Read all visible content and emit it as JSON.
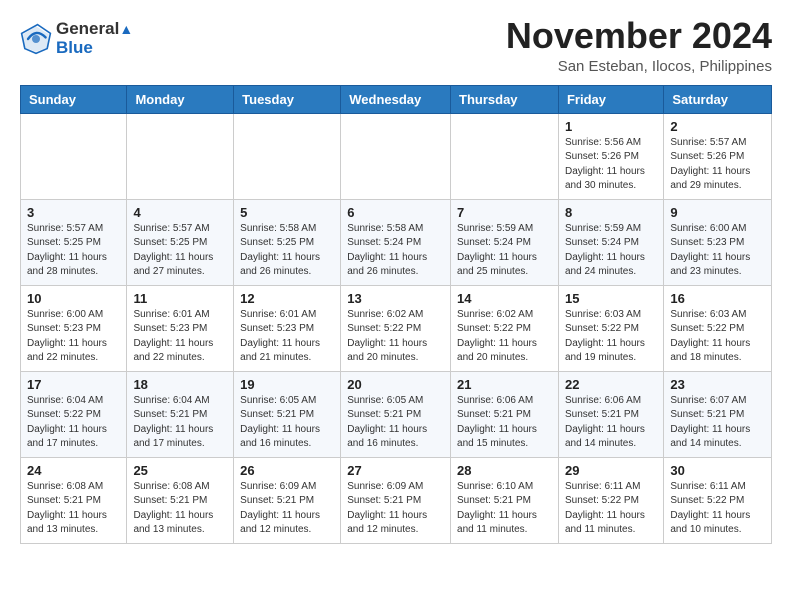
{
  "header": {
    "logo_line1": "General",
    "logo_line2": "Blue",
    "month": "November 2024",
    "location": "San Esteban, Ilocos, Philippines"
  },
  "weekdays": [
    "Sunday",
    "Monday",
    "Tuesday",
    "Wednesday",
    "Thursday",
    "Friday",
    "Saturday"
  ],
  "weeks": [
    [
      {
        "day": "",
        "info": ""
      },
      {
        "day": "",
        "info": ""
      },
      {
        "day": "",
        "info": ""
      },
      {
        "day": "",
        "info": ""
      },
      {
        "day": "",
        "info": ""
      },
      {
        "day": "1",
        "info": "Sunrise: 5:56 AM\nSunset: 5:26 PM\nDaylight: 11 hours and 30 minutes."
      },
      {
        "day": "2",
        "info": "Sunrise: 5:57 AM\nSunset: 5:26 PM\nDaylight: 11 hours and 29 minutes."
      }
    ],
    [
      {
        "day": "3",
        "info": "Sunrise: 5:57 AM\nSunset: 5:25 PM\nDaylight: 11 hours and 28 minutes."
      },
      {
        "day": "4",
        "info": "Sunrise: 5:57 AM\nSunset: 5:25 PM\nDaylight: 11 hours and 27 minutes."
      },
      {
        "day": "5",
        "info": "Sunrise: 5:58 AM\nSunset: 5:25 PM\nDaylight: 11 hours and 26 minutes."
      },
      {
        "day": "6",
        "info": "Sunrise: 5:58 AM\nSunset: 5:24 PM\nDaylight: 11 hours and 26 minutes."
      },
      {
        "day": "7",
        "info": "Sunrise: 5:59 AM\nSunset: 5:24 PM\nDaylight: 11 hours and 25 minutes."
      },
      {
        "day": "8",
        "info": "Sunrise: 5:59 AM\nSunset: 5:24 PM\nDaylight: 11 hours and 24 minutes."
      },
      {
        "day": "9",
        "info": "Sunrise: 6:00 AM\nSunset: 5:23 PM\nDaylight: 11 hours and 23 minutes."
      }
    ],
    [
      {
        "day": "10",
        "info": "Sunrise: 6:00 AM\nSunset: 5:23 PM\nDaylight: 11 hours and 22 minutes."
      },
      {
        "day": "11",
        "info": "Sunrise: 6:01 AM\nSunset: 5:23 PM\nDaylight: 11 hours and 22 minutes."
      },
      {
        "day": "12",
        "info": "Sunrise: 6:01 AM\nSunset: 5:23 PM\nDaylight: 11 hours and 21 minutes."
      },
      {
        "day": "13",
        "info": "Sunrise: 6:02 AM\nSunset: 5:22 PM\nDaylight: 11 hours and 20 minutes."
      },
      {
        "day": "14",
        "info": "Sunrise: 6:02 AM\nSunset: 5:22 PM\nDaylight: 11 hours and 20 minutes."
      },
      {
        "day": "15",
        "info": "Sunrise: 6:03 AM\nSunset: 5:22 PM\nDaylight: 11 hours and 19 minutes."
      },
      {
        "day": "16",
        "info": "Sunrise: 6:03 AM\nSunset: 5:22 PM\nDaylight: 11 hours and 18 minutes."
      }
    ],
    [
      {
        "day": "17",
        "info": "Sunrise: 6:04 AM\nSunset: 5:22 PM\nDaylight: 11 hours and 17 minutes."
      },
      {
        "day": "18",
        "info": "Sunrise: 6:04 AM\nSunset: 5:21 PM\nDaylight: 11 hours and 17 minutes."
      },
      {
        "day": "19",
        "info": "Sunrise: 6:05 AM\nSunset: 5:21 PM\nDaylight: 11 hours and 16 minutes."
      },
      {
        "day": "20",
        "info": "Sunrise: 6:05 AM\nSunset: 5:21 PM\nDaylight: 11 hours and 16 minutes."
      },
      {
        "day": "21",
        "info": "Sunrise: 6:06 AM\nSunset: 5:21 PM\nDaylight: 11 hours and 15 minutes."
      },
      {
        "day": "22",
        "info": "Sunrise: 6:06 AM\nSunset: 5:21 PM\nDaylight: 11 hours and 14 minutes."
      },
      {
        "day": "23",
        "info": "Sunrise: 6:07 AM\nSunset: 5:21 PM\nDaylight: 11 hours and 14 minutes."
      }
    ],
    [
      {
        "day": "24",
        "info": "Sunrise: 6:08 AM\nSunset: 5:21 PM\nDaylight: 11 hours and 13 minutes."
      },
      {
        "day": "25",
        "info": "Sunrise: 6:08 AM\nSunset: 5:21 PM\nDaylight: 11 hours and 13 minutes."
      },
      {
        "day": "26",
        "info": "Sunrise: 6:09 AM\nSunset: 5:21 PM\nDaylight: 11 hours and 12 minutes."
      },
      {
        "day": "27",
        "info": "Sunrise: 6:09 AM\nSunset: 5:21 PM\nDaylight: 11 hours and 12 minutes."
      },
      {
        "day": "28",
        "info": "Sunrise: 6:10 AM\nSunset: 5:21 PM\nDaylight: 11 hours and 11 minutes."
      },
      {
        "day": "29",
        "info": "Sunrise: 6:11 AM\nSunset: 5:22 PM\nDaylight: 11 hours and 11 minutes."
      },
      {
        "day": "30",
        "info": "Sunrise: 6:11 AM\nSunset: 5:22 PM\nDaylight: 11 hours and 10 minutes."
      }
    ]
  ]
}
